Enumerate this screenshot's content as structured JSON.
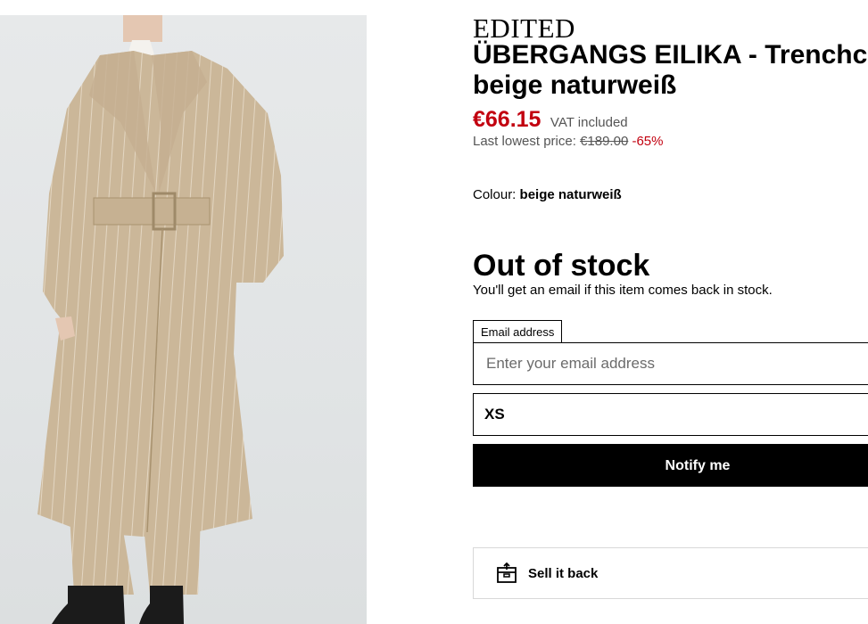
{
  "product": {
    "image_alt": "Model wearing beige pinstripe belted trenchcoat",
    "brand": "EDITED",
    "title_line1": "ÜBERGANGS EILIKA - Trenchcoat",
    "title_line2": "beige naturweiß",
    "price": "€66.15",
    "vat": "VAT included",
    "lowest_label": "Last lowest price:",
    "lowest_price": "€189.00",
    "discount": "-65%",
    "colour_label": "Colour:",
    "colour_value": "beige naturweiß"
  },
  "stock": {
    "title": "Out of stock",
    "subtitle": "You'll get an email if this item comes back in stock."
  },
  "notify_form": {
    "email_label": "Email address",
    "email_placeholder": "Enter your email address",
    "email_value": "",
    "size_selected": "XS",
    "submit_label": "Notify me"
  },
  "sell_back": {
    "icon": "box-arrow-icon",
    "label": "Sell it back"
  },
  "colors": {
    "price_red": "#c2000f",
    "coat": "#cdb89b",
    "background_photo": "#e3e6e7"
  }
}
